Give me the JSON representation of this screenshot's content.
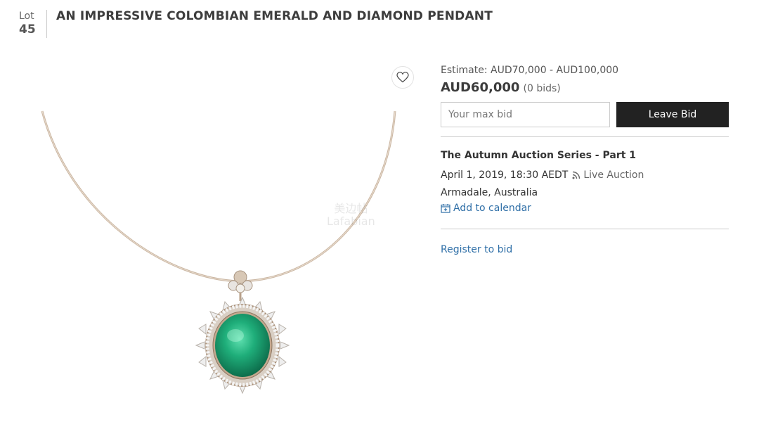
{
  "lot": {
    "label": "Lot",
    "number": "45",
    "title": "AN IMPRESSIVE COLOMBIAN EMERALD AND DIAMOND PENDANT"
  },
  "image": {
    "alt": "Emerald and diamond pendant on wire necklace",
    "watermark_line1": "美边帖",
    "watermark_line2": "Lafabian"
  },
  "favorite": {
    "icon": "heart-icon"
  },
  "pricing": {
    "estimate": "Estimate: AUD70,000 - AUD100,000",
    "current_price": "AUD60,000",
    "bids": "(0 bids)",
    "max_bid_placeholder": "Your max bid",
    "max_bid_value": "",
    "leave_bid_label": "Leave Bid"
  },
  "auction": {
    "title": "The Autumn Auction Series - Part 1",
    "date": "April 1, 2019, 18:30 AEDT",
    "live_label": "Live Auction",
    "live_icon": "rss-icon",
    "location": "Armadale, Australia",
    "calendar_label": "Add to calendar",
    "calendar_icon": "calendar-plus-icon"
  },
  "register_label": "Register to bid",
  "colors": {
    "link": "#2f6fa7",
    "button_bg": "#222222",
    "emerald": "#1fae7a"
  }
}
